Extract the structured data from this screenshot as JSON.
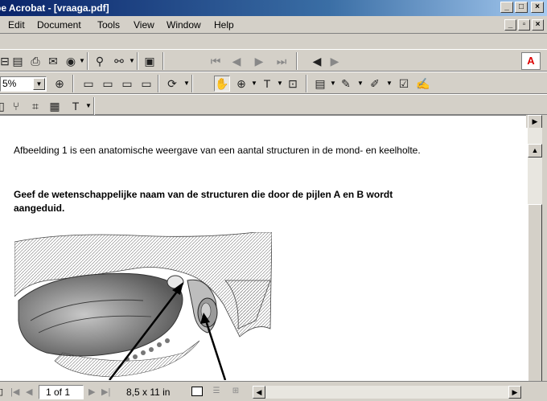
{
  "window": {
    "title": "be Acrobat - [vraaga.pdf]",
    "controls": [
      "_",
      "□",
      "×"
    ]
  },
  "menu": {
    "items": [
      "Edit",
      "Document",
      "Tools",
      "View",
      "Window",
      "Help"
    ],
    "doc_controls": [
      "_",
      "▫",
      "×"
    ]
  },
  "toolbar": {
    "zoom_value": "5%",
    "adobe_label": "A"
  },
  "document": {
    "paragraph1": "Afbeelding 1 is een anatomische weergave van een aantal structuren in de mond- en keelholte.",
    "paragraph2": "Geef de wetenschappelijke naam van de structuren die door de pijlen A en B wordt aangeduid."
  },
  "status": {
    "page_indicator": "1 of 1",
    "page_size": "8,5 x 11 in"
  },
  "colors": {
    "titlebar_start": "#0a246a",
    "titlebar_end": "#a6caf0",
    "chrome": "#d4d0c8"
  }
}
